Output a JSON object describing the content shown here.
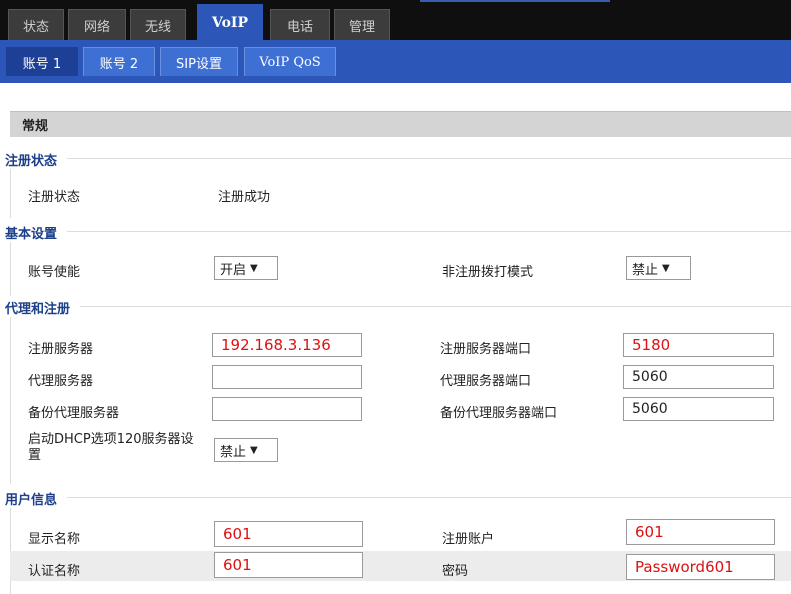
{
  "top_tabs": [
    {
      "label": "状态",
      "active": false
    },
    {
      "label": "网络",
      "active": false
    },
    {
      "label": "无线",
      "active": false
    },
    {
      "label": "VoIP",
      "active": true
    },
    {
      "label": "电话",
      "active": false
    },
    {
      "label": "管理",
      "active": false
    }
  ],
  "sub_tabs": [
    {
      "label": "账号 1",
      "active": true
    },
    {
      "label": "账号 2",
      "active": false
    },
    {
      "label": "SIP设置",
      "active": false
    },
    {
      "label": "VoIP QoS",
      "active": false
    }
  ],
  "section": {
    "title": "常规"
  },
  "registration_status": {
    "group_title": "注册状态",
    "label": "注册状态",
    "value": "注册成功"
  },
  "basic_settings": {
    "group_title": "基本设置",
    "account_enable": {
      "label": "账号使能",
      "value": "开启"
    },
    "unregistered_dial": {
      "label": "非注册拨打模式",
      "value": "禁止"
    }
  },
  "proxy_registration": {
    "group_title": "代理和注册",
    "register_server": {
      "label": "注册服务器",
      "value": "192.168.3.136"
    },
    "register_server_port": {
      "label": "注册服务器端口",
      "value": "5180"
    },
    "proxy_server": {
      "label": "代理服务器",
      "value": ""
    },
    "proxy_server_port": {
      "label": "代理服务器端口",
      "value": "5060"
    },
    "backup_proxy_server": {
      "label": "备份代理服务器",
      "value": ""
    },
    "backup_proxy_server_port": {
      "label": "备份代理服务器端口",
      "value": "5060"
    },
    "dhcp_option120": {
      "label_line1": "启动DHCP选项120服务器设",
      "label_line2": "置",
      "value": "禁止"
    }
  },
  "user_info": {
    "group_title": "用户信息",
    "display_name": {
      "label": "显示名称",
      "value": "601"
    },
    "register_account": {
      "label": "注册账户",
      "value": "601"
    },
    "auth_name": {
      "label": "认证名称",
      "value": "601"
    },
    "password": {
      "label": "密码",
      "value": "Password601"
    }
  },
  "colors": {
    "accent_blue": "#2c56b8",
    "active_sub_tab": "#1e3f96",
    "group_title_blue": "#1e3f8a",
    "highlight_red": "#dd1111"
  },
  "icons": {
    "dropdown": "▼"
  }
}
